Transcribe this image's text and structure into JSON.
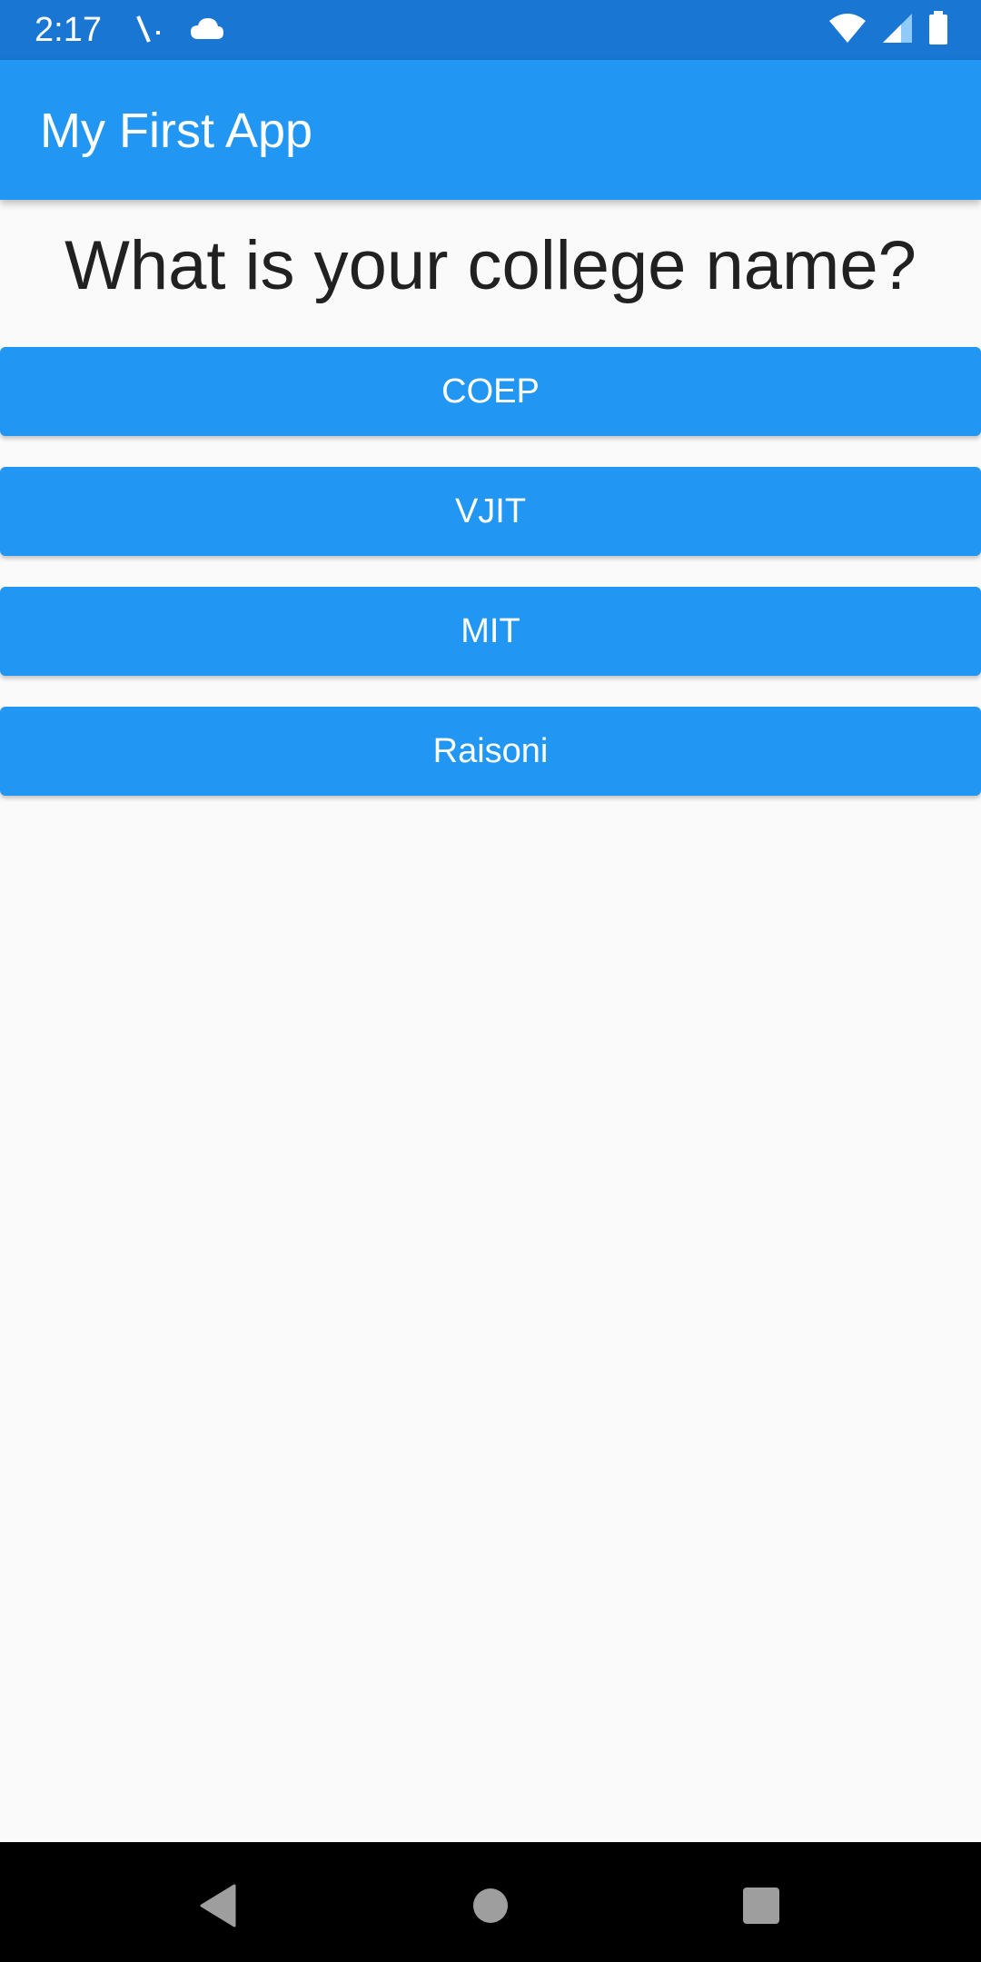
{
  "status_bar": {
    "time": "2:17",
    "left_icons": [
      "signal-scan-icon",
      "cloud-icon"
    ],
    "right_icons": [
      "wifi-icon",
      "cell-signal-icon",
      "battery-icon"
    ],
    "color": "#1976d2"
  },
  "app_bar": {
    "title": "My First App",
    "color": "#2196f3"
  },
  "question": {
    "text": "What is your college name?"
  },
  "answers": [
    {
      "label": "COEP"
    },
    {
      "label": "VJIT"
    },
    {
      "label": "MIT"
    },
    {
      "label": "Raisoni"
    }
  ],
  "nav_bar": {
    "buttons": [
      "back-icon",
      "home-icon",
      "recents-icon"
    ]
  },
  "colors": {
    "accent": "#2196f3",
    "background": "#fafafa",
    "text": "#212121"
  }
}
